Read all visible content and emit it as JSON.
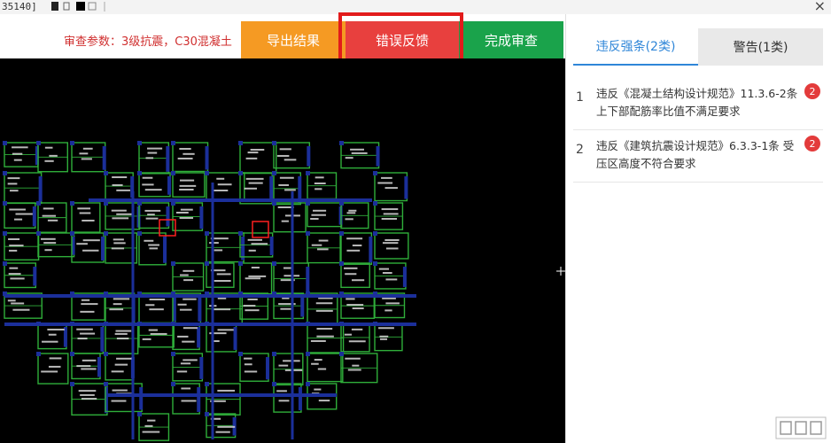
{
  "window": {
    "title_fragment": "35140]",
    "close_glyph": "×"
  },
  "toolbar": {
    "review_params": "审查参数：3级抗震，C30混凝土",
    "export_label": "导出结果",
    "feedback_label": "错误反馈",
    "finish_label": "完成审查"
  },
  "tabs": {
    "violations_label": "违反强条(2类)",
    "warnings_label": "警告(1类)"
  },
  "violations": [
    {
      "index": "1",
      "text": "违反《混凝土结构设计规范》11.3.6-2条 上下部配筋率比值不满足要求",
      "count": "2"
    },
    {
      "index": "2",
      "text": "违反《建筑抗震设计规范》6.3.3-1条 受压区高度不符合要求",
      "count": "2"
    }
  ],
  "colors": {
    "export": "#f59a23",
    "feedback": "#e8403e",
    "finish": "#1aa34b",
    "highlight": "#e21b1b",
    "tab_active": "#2f86d8",
    "badge": "#e33b3b",
    "canvas_bg": "#000000",
    "beam_green": "#2fae3a",
    "wall_blue": "#1b2f9a"
  },
  "icons": [
    "close-icon",
    "cad-drawing",
    "download-watermark-icon"
  ]
}
